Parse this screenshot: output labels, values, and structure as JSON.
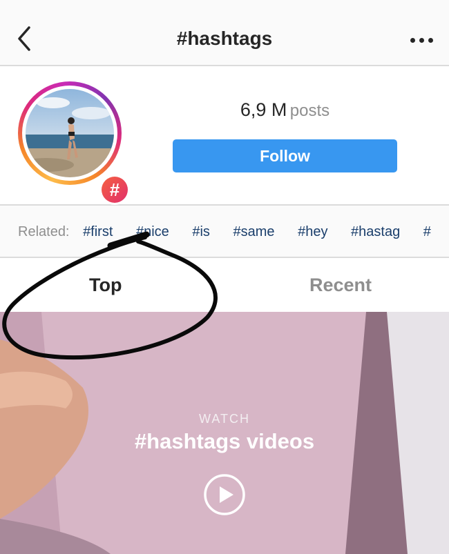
{
  "header": {
    "title": "#hashtags",
    "back_icon": "chevron-left-icon",
    "more_icon": "more-horizontal-icon"
  },
  "profile": {
    "post_count": "6,9 M",
    "post_unit": "posts",
    "follow_label": "Follow",
    "badge_symbol": "#"
  },
  "related": {
    "label": "Related:",
    "tags": [
      "#first",
      "#nice",
      "#is",
      "#same",
      "#hey",
      "#hastag",
      "#"
    ]
  },
  "tabs": {
    "top": "Top",
    "recent": "Recent"
  },
  "video": {
    "watch": "WATCH",
    "title": "#hashtags videos",
    "play_icon": "play-circle-icon"
  },
  "colors": {
    "follow_blue": "#3897f0",
    "tag_blue": "#1a3e6b",
    "muted": "#8e8e8e",
    "divider": "#dbdbdb"
  }
}
